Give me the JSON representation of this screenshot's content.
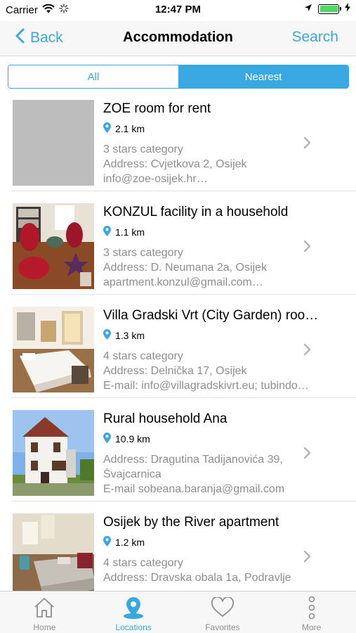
{
  "status_bar": {
    "carrier": "Carrier",
    "time": "12:47 PM",
    "battery_level": 1.0
  },
  "nav": {
    "back_label": "Back",
    "title": "Accommodation",
    "search_label": "Search"
  },
  "segments": [
    {
      "label": "All",
      "active": false
    },
    {
      "label": "Nearest",
      "active": true
    }
  ],
  "items": [
    {
      "title": "ZOE room for rent",
      "distance": "2.1 km",
      "line1": "3 stars category",
      "line2": "Address: Cvjetkova 2, Osijek",
      "line3": "info@zoe-osijek.hr…",
      "image": "placeholder"
    },
    {
      "title": "KONZUL facility in a household",
      "distance": "1.1 km",
      "line1": "3 stars category",
      "line2": "Address: D. Neumana 2a, Osijek",
      "line3": "apartment.konzul@gmail.com…",
      "image": "red-armchairs-room-photo"
    },
    {
      "title": "Villa Gradski Vrt (City Garden) roo…",
      "distance": "1.3 km",
      "line1": "4 stars category",
      "line2": "Address: Delnička 17, Osijek",
      "line3": "E-mail: info@villagradskivrt.eu; tubindo…",
      "image": "bright-bedroom-photo"
    },
    {
      "title": "Rural household Ana",
      "distance": "10.9 km",
      "line1": "Address: Dragutina Tadijanovića 39,",
      "line2": "Švajcarnica",
      "line3": "E-mail sobeana.baranja@gmail.com",
      "image": "white-house-photo"
    },
    {
      "title": "Osijek by the River apartment",
      "distance": "1.2 km",
      "line1": "4 stars category",
      "line2": "Address: Dravska obala 1a, Podravlje",
      "line3": "",
      "image": "apartment-bedroom-photo"
    }
  ],
  "tabs": [
    {
      "label": "Home",
      "icon": "house-icon",
      "active": false
    },
    {
      "label": "Locations",
      "icon": "location-pin-icon",
      "active": true
    },
    {
      "label": "Favorites",
      "icon": "heart-icon",
      "active": false
    },
    {
      "label": "More",
      "icon": "more-dots-icon",
      "active": false
    }
  ],
  "colors": {
    "accent": "#3aa8e0",
    "secondary_text": "#8e8e8e",
    "battery": "#4cd964"
  }
}
